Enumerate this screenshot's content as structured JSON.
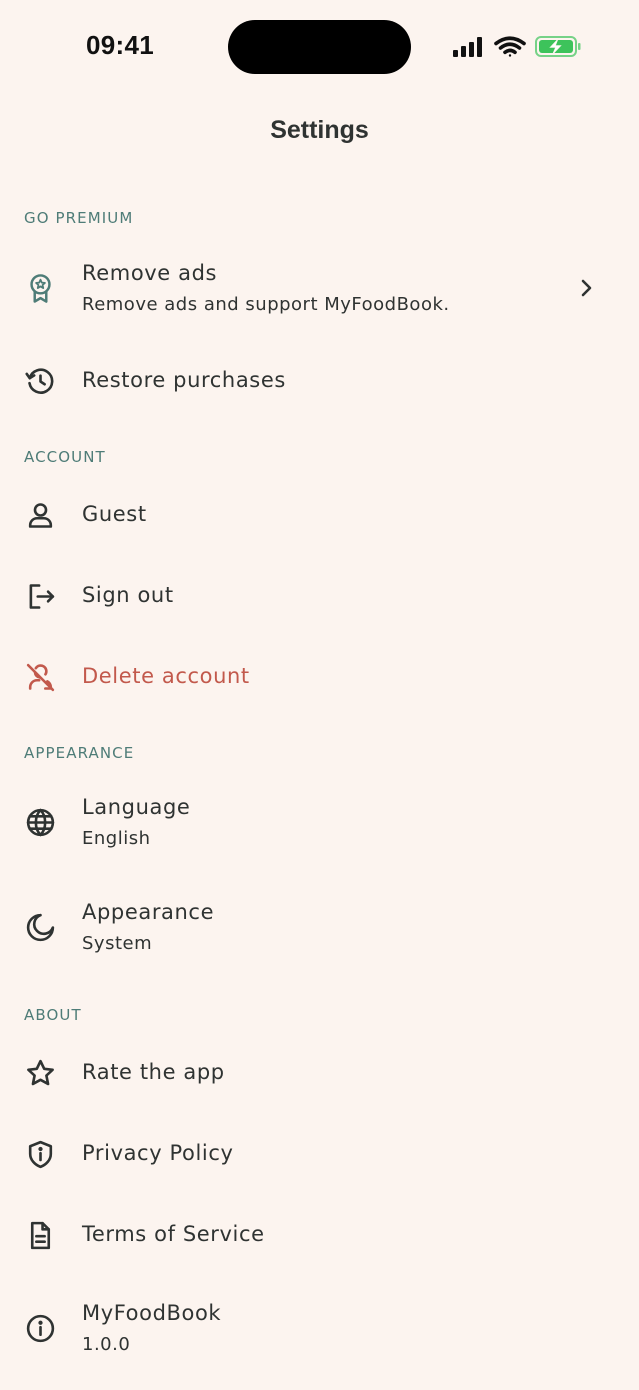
{
  "status_bar": {
    "time": "09:41",
    "icons": [
      "cellular-signal-icon",
      "wifi-icon",
      "battery-charging-icon"
    ],
    "battery_color": "#3DC35B"
  },
  "header": {
    "title": "Settings"
  },
  "sections": {
    "premium": {
      "heading": "GO PREMIUM",
      "remove_ads": {
        "label": "Remove ads",
        "subtitle": "Remove ads and support MyFoodBook.",
        "icon": "award-icon"
      },
      "restore": {
        "label": "Restore purchases",
        "icon": "history-icon"
      }
    },
    "account": {
      "heading": "ACCOUNT",
      "guest": {
        "label": "Guest",
        "icon": "user-icon"
      },
      "sign_out": {
        "label": "Sign out",
        "icon": "sign-out-icon"
      },
      "delete": {
        "label": "Delete account",
        "icon": "user-off-icon"
      }
    },
    "appearance": {
      "heading": "APPEARANCE",
      "language": {
        "label": "Language",
        "value": "English",
        "icon": "globe-icon"
      },
      "theme": {
        "label": "Appearance",
        "value": "System",
        "icon": "moon-icon"
      }
    },
    "about": {
      "heading": "ABOUT",
      "rate": {
        "label": "Rate the app",
        "icon": "star-icon"
      },
      "privacy": {
        "label": "Privacy Policy",
        "icon": "shield-info-icon"
      },
      "terms": {
        "label": "Terms of Service",
        "icon": "document-icon"
      },
      "app": {
        "label": "MyFoodBook",
        "version": "1.0.0",
        "icon": "info-icon"
      }
    }
  },
  "colors": {
    "background": "#FCF4EF",
    "text": "#2F3332",
    "section_heading": "#4E7C77",
    "premium_icon": "#4E7C77",
    "danger": "#C2594C"
  }
}
